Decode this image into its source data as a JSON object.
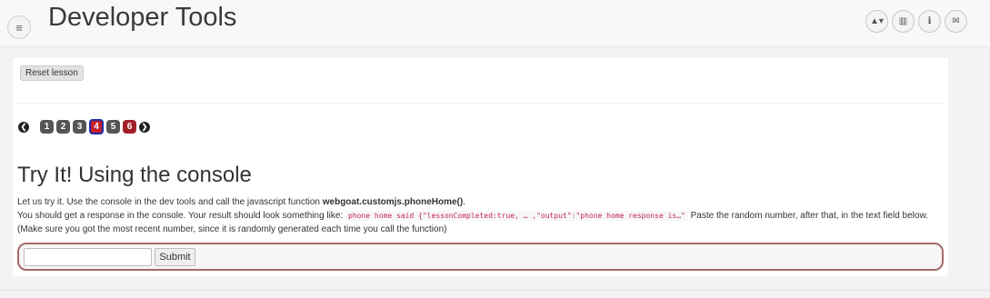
{
  "header": {
    "title": "Developer Tools",
    "menu_icon": "≡",
    "icons": [
      {
        "name": "user-icon",
        "glyph": "▲▾"
      },
      {
        "name": "report-card-icon",
        "glyph": "▥"
      },
      {
        "name": "info-icon",
        "glyph": "i"
      },
      {
        "name": "envelope-icon",
        "glyph": "✉"
      }
    ]
  },
  "toolbar": {
    "reset_label": "Reset lesson"
  },
  "pager": {
    "prev": "❮",
    "next": "❯",
    "pages": [
      "1",
      "2",
      "3",
      "4",
      "5",
      "6"
    ],
    "current": "4",
    "colors": {
      "visited": "#555555",
      "current": "#c21f2a",
      "current_border": "#1e2aa7",
      "incomplete": "#a3202a"
    }
  },
  "lesson": {
    "title": "Try It! Using the console",
    "line1_prefix": "Let us try it. Use the console in the dev tools and call the javascript function ",
    "line1_bold": "webgoat.customjs.phoneHome()",
    "line1_suffix": ".",
    "line2_prefix": "You should get a response in the console. Your result should look something like: ",
    "line2_code": "phone home said {\"lessonCompleted:true, … ,\"output\":\"phone home response is…\"",
    "line2_suffix": " Paste the random number, after that, in the text field below. (Make sure you got the most recent number, since it is randomly generated each time you call the function)"
  },
  "form": {
    "input_value": "",
    "submit_label": "Submit"
  }
}
